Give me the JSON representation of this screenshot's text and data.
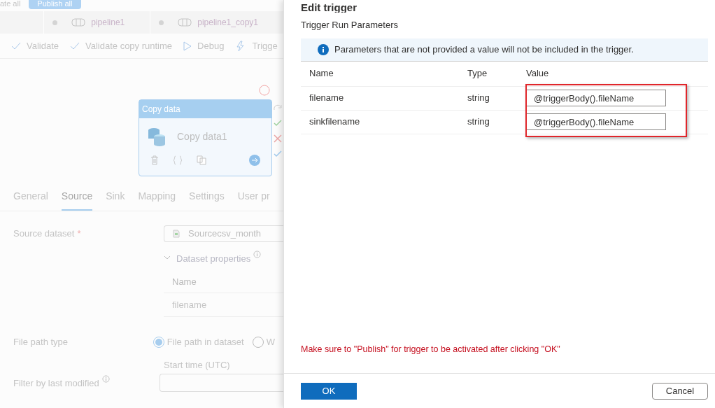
{
  "background": {
    "top_bar": {
      "cut_text": "ate all",
      "publish_button": "Publish all"
    },
    "pipeline_tabs": [
      {
        "label": "pipeline1"
      },
      {
        "label": "pipeline1_copy1"
      }
    ],
    "actions": [
      {
        "kind": "check",
        "label": "Validate"
      },
      {
        "kind": "check",
        "label": "Validate copy runtime"
      },
      {
        "kind": "play",
        "label": "Debug"
      },
      {
        "kind": "bolt",
        "label": "Trigge"
      }
    ],
    "activity": {
      "header": "Copy data",
      "name": "Copy data1"
    },
    "detail_tabs": [
      {
        "label": "General",
        "selected": false
      },
      {
        "label": "Source",
        "selected": true
      },
      {
        "label": "Sink",
        "selected": false
      },
      {
        "label": "Mapping",
        "selected": false
      },
      {
        "label": "Settings",
        "selected": false
      },
      {
        "label": "User pr",
        "selected": false
      }
    ],
    "source_dataset": {
      "label": "Source dataset",
      "required_mark": "*",
      "value": "Sourcecsv_month"
    },
    "dataset_properties": {
      "title": "Dataset properties",
      "column": "Name",
      "rows": [
        "filename"
      ]
    },
    "file_path_type": {
      "label": "File path type",
      "options": [
        {
          "label": "File path in dataset",
          "selected": true
        },
        {
          "label": "W",
          "selected": false
        }
      ]
    },
    "filter": {
      "label": "Filter by last modified",
      "start_label": "Start time (UTC)"
    }
  },
  "dialog": {
    "title": "Edit trigger",
    "section": "Trigger Run Parameters",
    "info": "Parameters that are not provided a value will not be included in the trigger.",
    "columns": [
      "Name",
      "Type",
      "Value"
    ],
    "rows": [
      {
        "name": "filename",
        "type": "string",
        "value": "@triggerBody().fileName"
      },
      {
        "name": "sinkfilename",
        "type": "string",
        "value": "@triggerBody().fileName"
      }
    ],
    "warning": "Make sure to \"Publish\" for trigger to be activated after clicking \"OK\"",
    "ok": "OK",
    "cancel": "Cancel"
  }
}
